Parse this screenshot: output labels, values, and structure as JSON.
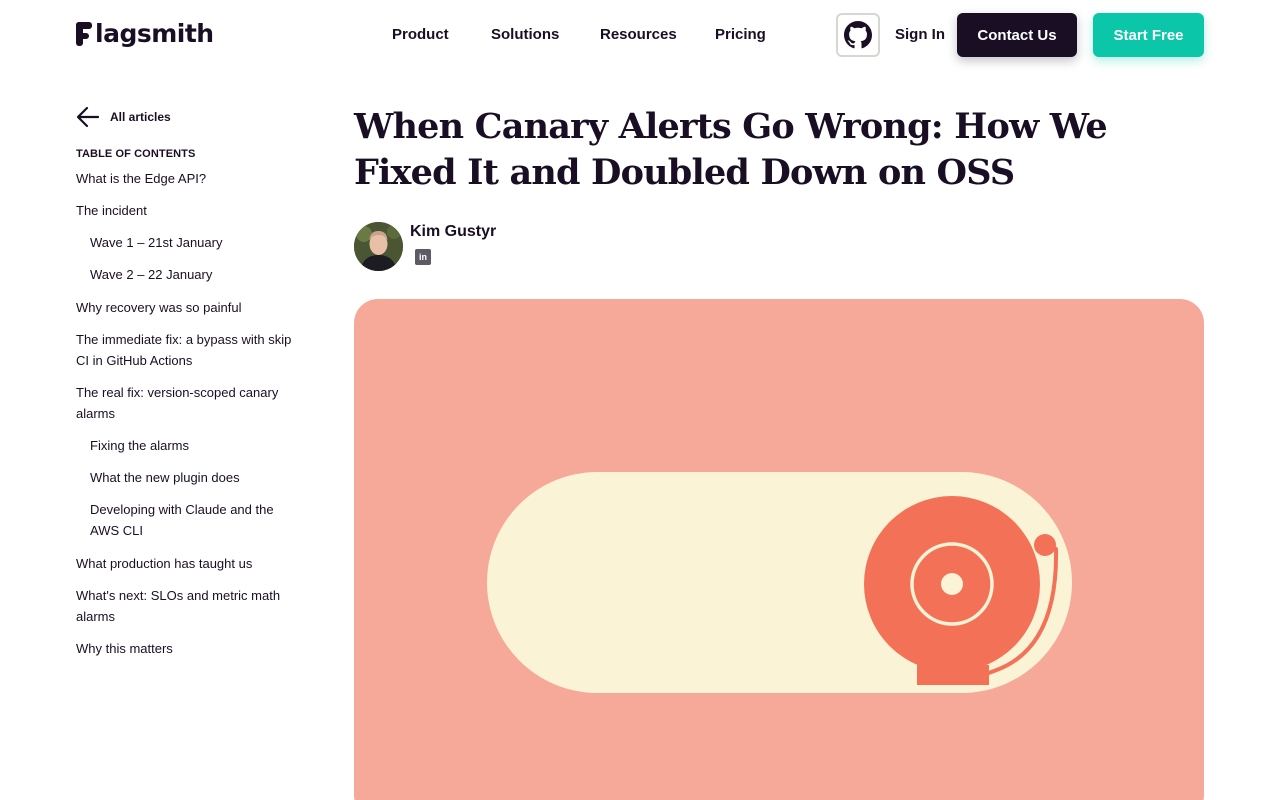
{
  "header": {
    "logo_text": "lagsmith",
    "nav": [
      "Product",
      "Solutions",
      "Resources",
      "Pricing"
    ],
    "sign_in": "Sign In",
    "contact": "Contact Us",
    "start": "Start Free",
    "github_icon": "github-icon"
  },
  "sidebar": {
    "back_label": "All articles",
    "toc_title": "TABLE OF CONTENTS",
    "toc": [
      {
        "label": "What is the Edge API?",
        "level": 1
      },
      {
        "label": "The incident",
        "level": 1
      },
      {
        "label": "Wave 1 – 21st January",
        "level": 2
      },
      {
        "label": "Wave 2 – 22 January",
        "level": 2
      },
      {
        "label": "Why recovery was so painful",
        "level": 1
      },
      {
        "label": "The immediate fix: a bypass with skip CI in GitHub Actions",
        "level": 1
      },
      {
        "label": "The real fix: version-scoped canary alarms",
        "level": 1
      },
      {
        "label": "Fixing the alarms",
        "level": 2
      },
      {
        "label": "What the new plugin does",
        "level": 2
      },
      {
        "label": "Developing with Claude and the AWS CLI",
        "level": 2
      },
      {
        "label": "What production has taught us",
        "level": 1
      },
      {
        "label": "What's next: SLOs and metric math alarms",
        "level": 1
      },
      {
        "label": "Why this matters",
        "level": 1
      }
    ]
  },
  "article": {
    "title": "When Canary Alerts Go Wrong: How We Fixed It and Doubled Down on OSS",
    "author": "Kim Gustyr",
    "linkedin": "in"
  },
  "colors": {
    "dark": "#1a0e24",
    "teal": "#0bc6a8",
    "hero_bg": "#f6a999",
    "toggle_bg": "#faf3d6",
    "bell": "#f37257"
  }
}
